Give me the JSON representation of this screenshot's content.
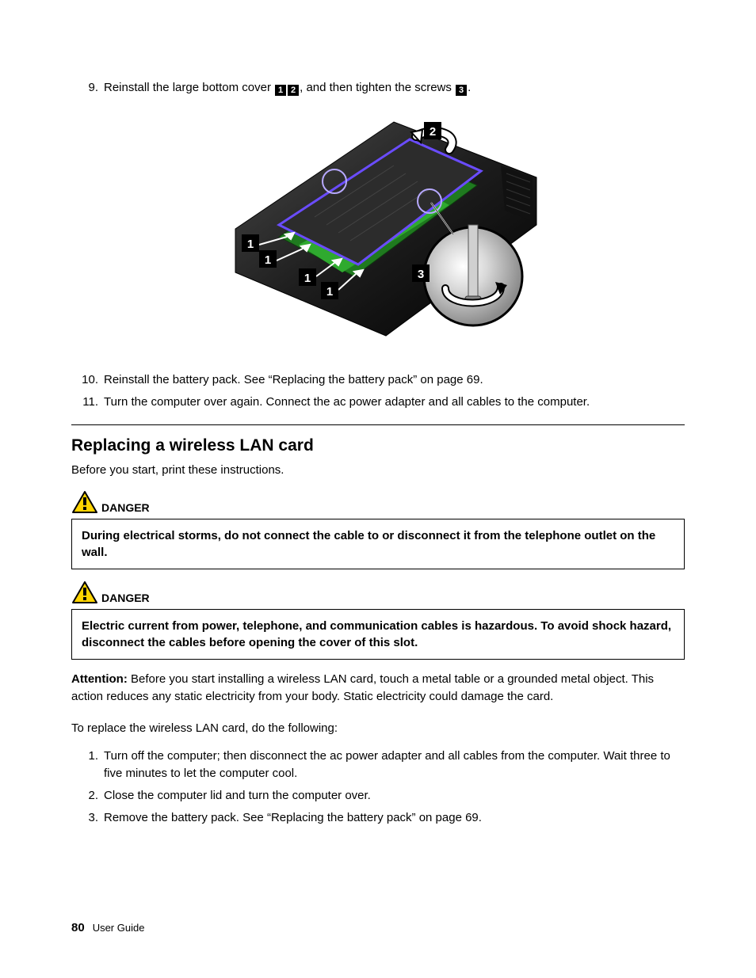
{
  "step9": {
    "num": "9.",
    "text_a": "Reinstall the large bottom cover ",
    "co1": "1",
    "co2": "2",
    "text_b": ", and then tighten the screws ",
    "co3": "3",
    "text_c": "."
  },
  "step10": {
    "num": "10.",
    "text": "Reinstall the battery pack.  See “Replacing the battery pack” on page 69."
  },
  "step11": {
    "num": "11.",
    "text": "Turn the computer over again.  Connect the ac power adapter and all cables to the computer."
  },
  "section_title": "Replacing a wireless LAN card",
  "intro": "Before you start, print these instructions.",
  "danger_label": "DANGER",
  "danger1": "During electrical storms, do not connect the cable to or disconnect it from the telephone outlet on the wall.",
  "danger2": "Electric current from power, telephone, and communication cables is hazardous.  To avoid shock hazard, disconnect the cables before opening the cover of this slot.",
  "attention_label": "Attention:",
  "attention_text": " Before you start installing a wireless LAN card, touch a metal table or a grounded metal object.  This action reduces any static electricity from your body.  Static electricity could damage the card.",
  "lead_in": "To replace the wireless LAN card, do the following:",
  "lan_steps": [
    {
      "num": "1.",
      "text": "Turn off the computer; then disconnect the ac power adapter and all cables from the computer.  Wait three to five minutes to let the computer cool."
    },
    {
      "num": "2.",
      "text": "Close the computer lid and turn the computer over."
    },
    {
      "num": "3.",
      "text": "Remove the battery pack.  See “Replacing the battery pack” on page 69."
    }
  ],
  "footer": {
    "page": "80",
    "title": "User Guide"
  },
  "fig": {
    "co1": "1",
    "co2": "2",
    "co3": "3"
  }
}
